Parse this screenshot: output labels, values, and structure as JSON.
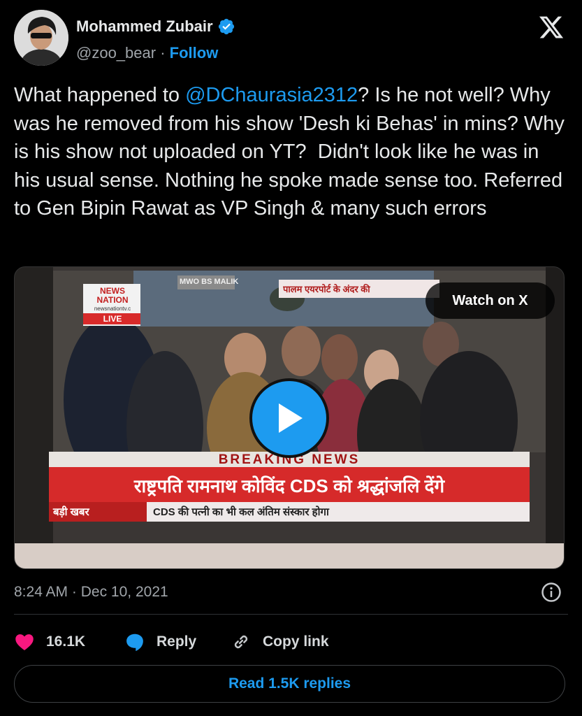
{
  "author": {
    "name": "Mohammed Zubair",
    "handle": "@zoo_bear",
    "separator": "·",
    "follow_label": "Follow",
    "verified": true
  },
  "tweet": {
    "text_before_mention": "What happened to ",
    "mention": "@DChaurasia2312",
    "text_after_mention": "? Is he not well? Why was he removed from his show 'Desh ki Behas' in mins? Why is his show not uploaded on YT?  Didn't look like he was in his usual sense. Nothing he spoke made sense too. Referred to Gen Bipin Rawat as VP Singh & many such errors"
  },
  "media": {
    "watch_label": "Watch on X",
    "tv": {
      "channel_logo_line1": "NEWS",
      "channel_logo_line2": "NATION",
      "channel_site": "newsnationtv.c",
      "live": "LIVE",
      "top_tag": "MWO BS MALIK",
      "top_right_caption": "पालम एयरपोर्ट के अंदर की",
      "breaking": "BREAKING NEWS",
      "headline": "राष्ट्रपति रामनाथ कोविंद CDS को श्रद्धांजलि देंगे",
      "ticker_label": "बड़ी खबर",
      "ticker_text": "CDS की पत्नी का भी कल अंतिम संस्कार होगा"
    }
  },
  "meta": {
    "time": "8:24 AM",
    "dot": "·",
    "date": "Dec 10, 2021"
  },
  "actions": {
    "likes": "16.1K",
    "reply_label": "Reply",
    "copy_label": "Copy link"
  },
  "read_replies_label": "Read 1.5K replies",
  "colors": {
    "accent": "#1d9bf0",
    "like": "#f91880",
    "background": "#000000"
  },
  "icons": [
    "x-logo-icon",
    "verified-badge-icon",
    "info-icon",
    "heart-icon",
    "reply-bubble-icon",
    "link-icon",
    "play-icon"
  ]
}
